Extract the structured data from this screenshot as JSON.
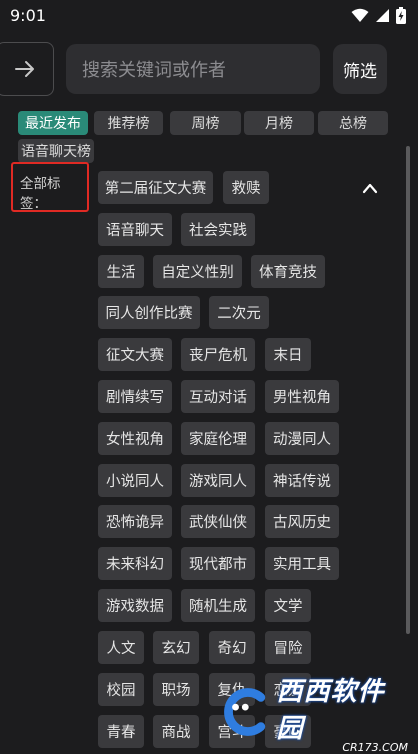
{
  "status_bar": {
    "time": "9:01"
  },
  "search": {
    "placeholder": "搜索关键词或作者"
  },
  "filter_label": "筛选",
  "rank_tabs": [
    {
      "label": "最近发布",
      "active": true
    },
    {
      "label": "推荐榜",
      "active": false
    },
    {
      "label": "周榜",
      "active": false
    },
    {
      "label": "月榜",
      "active": false
    },
    {
      "label": "总榜",
      "active": false
    },
    {
      "label": "语音聊天榜",
      "active": false
    }
  ],
  "all_tags_label": "全部标签：",
  "tags": [
    "第二届征文大赛",
    "救赎",
    "语音聊天",
    "社会实践",
    "生活",
    "自定义性别",
    "体育竞技",
    "同人创作比赛",
    "二次元",
    "征文大赛",
    "丧尸危机",
    "末日",
    "剧情续写",
    "互动对话",
    "男性视角",
    "女性视角",
    "家庭伦理",
    "动漫同人",
    "小说同人",
    "游戏同人",
    "神话传说",
    "恐怖诡异",
    "武侠仙侠",
    "古风历史",
    "未来科幻",
    "现代都市",
    "实用工具",
    "游戏数据",
    "随机生成",
    "文学",
    "人文",
    "玄幻",
    "奇幻",
    "冒险",
    "校园",
    "职场",
    "复仇",
    "恋爱",
    "青春",
    "商战",
    "宫斗",
    "豪门"
  ],
  "watermark": {
    "title": "西西软件园",
    "sub": "CR173.COM"
  },
  "colors": {
    "accent": "#2a8a78",
    "background": "#1c1c1e",
    "chip": "#3a3a3d",
    "highlight_border": "#e02a24"
  }
}
